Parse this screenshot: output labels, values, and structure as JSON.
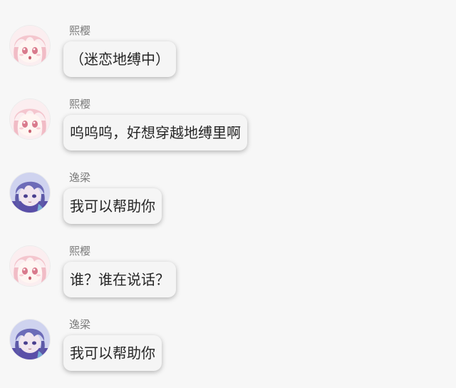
{
  "messages": [
    {
      "sender": "熙樱",
      "avatar": "pink-hair-girl-avatar",
      "text": "（迷恋地缚中）"
    },
    {
      "sender": "熙樱",
      "avatar": "pink-hair-girl-avatar",
      "text": "呜呜呜，好想穿越地缚里啊"
    },
    {
      "sender": "逸梁",
      "avatar": "purple-hair-boy-avatar",
      "text": "我可以帮助你"
    },
    {
      "sender": "熙樱",
      "avatar": "pink-hair-girl-avatar",
      "text": "谁？谁在说话？"
    },
    {
      "sender": "逸梁",
      "avatar": "purple-hair-boy-avatar",
      "text": "我可以帮助你"
    }
  ],
  "colors": {
    "background": "#f7f7f7",
    "bubble": "#f5f5f5",
    "name_text": "#7a7a7a",
    "message_text": "#262626"
  }
}
